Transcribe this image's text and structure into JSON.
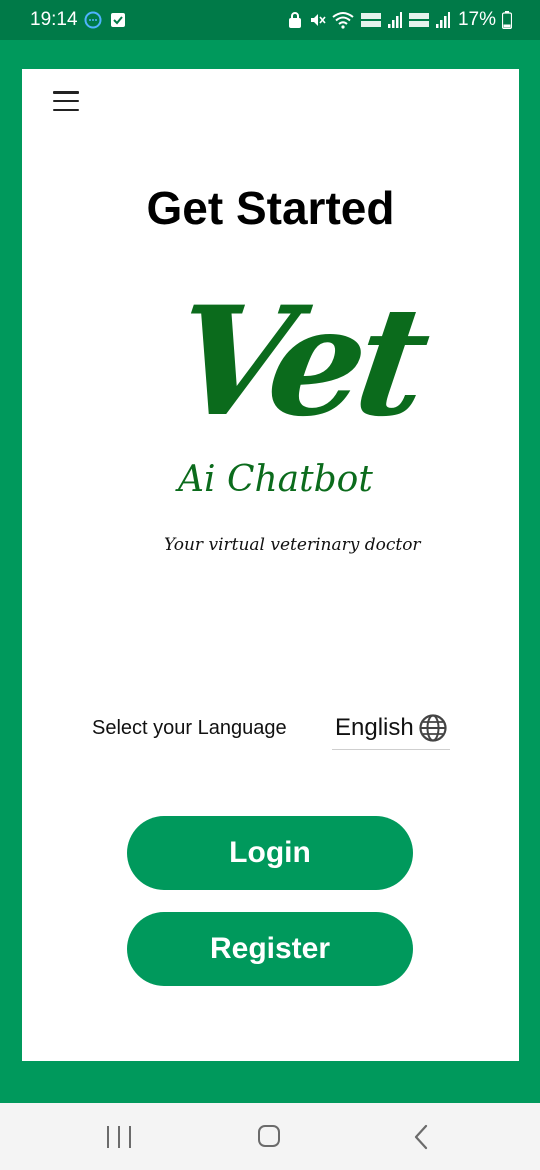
{
  "status_bar": {
    "time": "19:14",
    "battery_percent": "17%",
    "icons": [
      "chat-bubble-icon",
      "checkbox-icon",
      "lock-icon",
      "mute-icon",
      "wifi-icon",
      "volte-lte1-icon",
      "signal-icon",
      "volte-lte2-icon",
      "signal-icon",
      "battery-icon"
    ]
  },
  "header": {
    "menu_icon": "hamburger-menu-icon",
    "title": "Get Started"
  },
  "logo": {
    "word": "Vet",
    "subtitle": "Ai Chatbot",
    "tagline": "Your virtual veterinary doctor"
  },
  "language": {
    "label": "Select your Language",
    "selected": "English",
    "icon": "globe-icon"
  },
  "buttons": {
    "login": "Login",
    "register": "Register"
  },
  "nav_bar": {
    "icons": [
      "recent-apps-icon",
      "home-icon",
      "back-icon"
    ]
  },
  "colors": {
    "primary_green": "#00995c",
    "status_bar": "#007a48",
    "logo_green": "#0b6b1c",
    "card": "#ffffff"
  }
}
